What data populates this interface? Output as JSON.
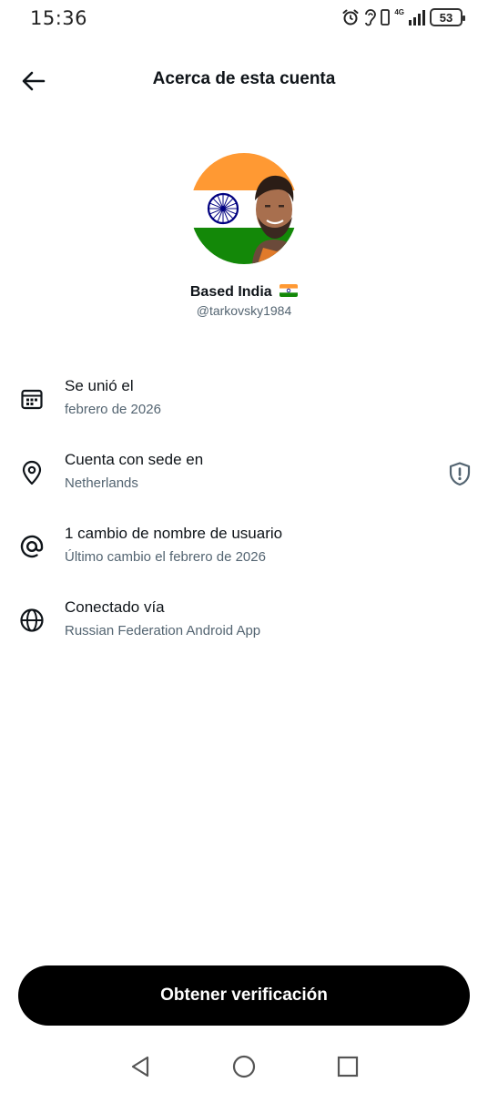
{
  "status_bar": {
    "time": "15:36",
    "network": "4G",
    "battery": "53"
  },
  "header": {
    "title": "Acerca de esta cuenta"
  },
  "profile": {
    "display_name": "Based India",
    "flag_icon": "india-flag-icon",
    "handle": "@tarkovsky1984"
  },
  "info_rows": [
    {
      "icon": "calendar-icon",
      "title": "Se unió el",
      "subtitle": "febrero de 2026"
    },
    {
      "icon": "location-pin-icon",
      "title": "Cuenta con sede en",
      "subtitle": "Netherlands",
      "badge_icon": "shield-alert-icon"
    },
    {
      "icon": "at-sign-icon",
      "title": "1 cambio de nombre de usuario",
      "subtitle": "Último cambio el febrero de 2026"
    },
    {
      "icon": "globe-icon",
      "title": "Conectado vía",
      "subtitle": "Russian Federation Android App"
    }
  ],
  "cta": {
    "label": "Obtener verificación"
  },
  "nav_bar": {
    "icons": [
      "back-triangle-icon",
      "home-circle-icon",
      "recents-square-icon"
    ]
  },
  "colors": {
    "primary_text": "#0f1419",
    "secondary_text": "#536471",
    "cta_background": "#000000",
    "saffron": "#FF9933",
    "india_green": "#138808",
    "chakra_blue": "#000080"
  }
}
